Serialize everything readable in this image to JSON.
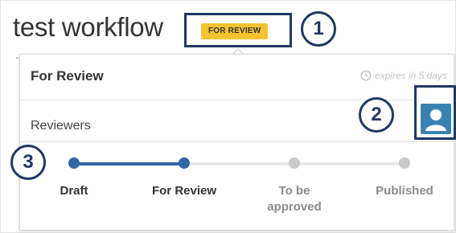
{
  "page": {
    "title": "test workflow"
  },
  "status": {
    "badge": "FOR REVIEW"
  },
  "callouts": [
    "1",
    "2",
    "3"
  ],
  "panel": {
    "title": "For Review",
    "expires": "expires in 5 days",
    "reviewers_label": "Reviewers"
  },
  "workflow": {
    "steps": [
      {
        "label": "Draft",
        "state": "complete"
      },
      {
        "label": "For Review",
        "state": "current"
      },
      {
        "label": "To be approved",
        "state": "pending"
      },
      {
        "label": "Published",
        "state": "pending"
      }
    ]
  },
  "colors": {
    "badge": "#f4c430",
    "callout": "#1f3864",
    "progress_active": "#2f66a6",
    "progress_inactive": "#e6e6e6",
    "pending_dot": "#c9c9c9",
    "avatar": "#3b82b4"
  },
  "icons": {
    "expires": "clock-icon",
    "reviewer": "user-avatar-icon"
  }
}
